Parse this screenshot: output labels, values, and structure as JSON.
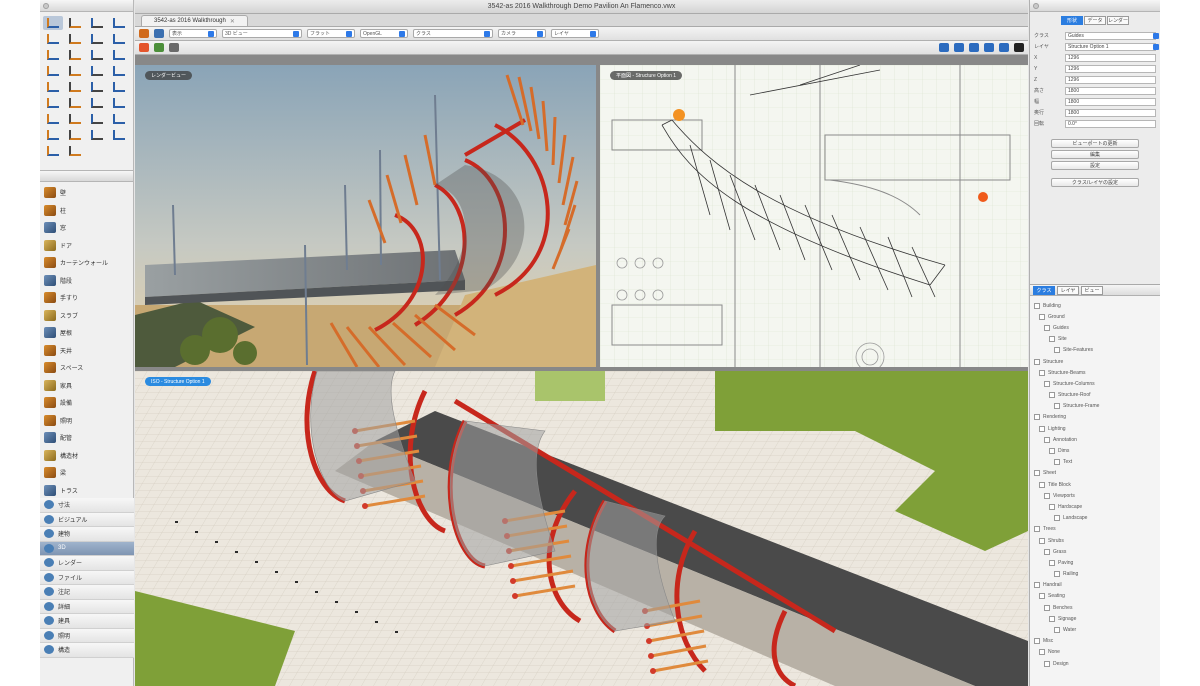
{
  "window": {
    "title": "3542-as 2016 Walkthrough Demo Pavilion An Flamenco.vwx",
    "tab_label": "3542-as 2016 Walkthrough"
  },
  "basic_palette": {
    "tools": [
      "select",
      "pan",
      "flyover",
      "text",
      "2d-reshape",
      "3d-rotate",
      "zoom",
      "rotate",
      "line",
      "double-line",
      "rectangle",
      "rounded-rect",
      "circle",
      "arc",
      "freehand",
      "polyline",
      "polygon",
      "regular-polygon",
      "spiral",
      "ellipse",
      "quarter-arc",
      "eyedropper",
      "offset",
      "mirror",
      "move",
      "split",
      "trim",
      "connect",
      "locus",
      "dimension",
      "stake",
      "callout",
      "wall",
      "column"
    ]
  },
  "tool_sets": {
    "items": [
      "壁",
      "柱",
      "窓",
      "ドア",
      "カーテンウォール",
      "階段",
      "手すり",
      "スラブ",
      "屋根",
      "天井",
      "スペース",
      "家具",
      "設備",
      "照明",
      "配管",
      "構造材",
      "梁",
      "トラス",
      "外構",
      "植栽",
      "地形",
      "敷地モデル",
      "測量",
      "レンダリング"
    ],
    "bottom_sets": [
      "寸法",
      "ビジュアル",
      "建物",
      "3D",
      "レンダー",
      "ファイル",
      "注記",
      "詳細",
      "建具",
      "照明",
      "構造"
    ],
    "active_bottom": "3D"
  },
  "toolbar": {
    "view_popups": [
      "表示",
      "3D ビュー",
      "フラット",
      "OpenGL",
      "クラス",
      "カメラ",
      "レイヤ"
    ],
    "active_class": "Structure Level",
    "render_mode": "OpenGL"
  },
  "viewports": [
    {
      "label": "レンダービュー",
      "kind": "render"
    },
    {
      "label": "平面図 - Structure Option 1",
      "kind": "plan"
    },
    {
      "label": "ISO - Structure Option 1",
      "kind": "iso"
    }
  ],
  "obj_info": {
    "tabs": [
      "形状",
      "データ",
      "レンダー"
    ],
    "active_tab": "形状",
    "rows": [
      {
        "label": "クラス",
        "value": "Guides"
      },
      {
        "label": "レイヤ",
        "value": "Structure Option 1"
      },
      {
        "label": "X",
        "value": "1296"
      },
      {
        "label": "Y",
        "value": "1296"
      },
      {
        "label": "Z",
        "value": "1296"
      },
      {
        "label": "高さ",
        "value": "1800"
      },
      {
        "label": "幅",
        "value": "1800"
      },
      {
        "label": "奥行",
        "value": "1800"
      },
      {
        "label": "回転",
        "value": "0.0°"
      }
    ],
    "buttons": [
      "ビューポートの更新",
      "編集",
      "設定",
      "クラス/レイヤの設定"
    ]
  },
  "navigation": {
    "tabs": [
      "クラス",
      "レイヤ",
      "ビュー"
    ],
    "tree": [
      "Building",
      "Ground",
      "Guides",
      "Site",
      "Site-Features",
      "Structure",
      "Structure-Beams",
      "Structure-Columns",
      "Structure-Roof",
      "Structure-Frame",
      "Rendering",
      "Lighting",
      "Annotation",
      "Dims",
      "Text",
      "Sheet",
      "Title Block",
      "Viewports",
      "Hardscape",
      "Landscape",
      "Trees",
      "Shrubs",
      "Grass",
      "Paving",
      "Railing",
      "Handrail",
      "Seating",
      "Benches",
      "Signage",
      "Water",
      "Misc",
      "None",
      "Design"
    ]
  },
  "colors": {
    "accent": "#2b7de0",
    "structure": "#c7271c",
    "ground": "#7fa038"
  }
}
